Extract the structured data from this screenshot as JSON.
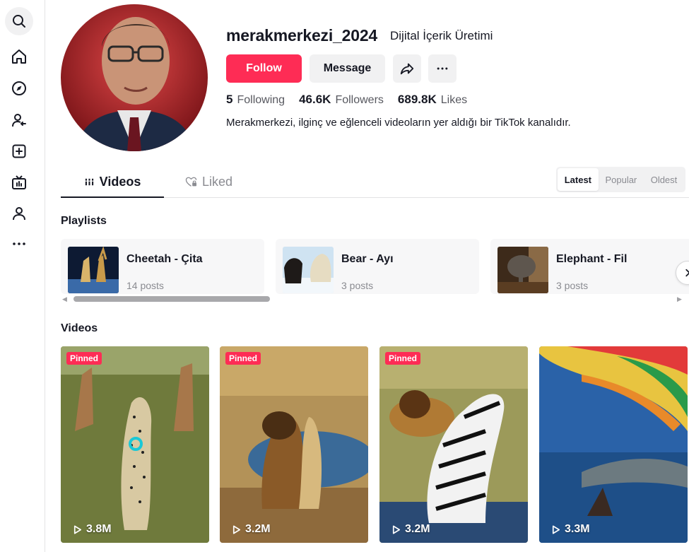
{
  "profile": {
    "username": "merakmerkezi_2024",
    "nickname": "Dijital İçerik Üretimi",
    "bio": "Merakmerkezi, ilginç ve eğlenceli videoların yer aldığı bir TikTok kanalıdır."
  },
  "actions": {
    "follow_label": "Follow",
    "message_label": "Message"
  },
  "stats": {
    "following_count": "5",
    "following_label": "Following",
    "followers_count": "46.6K",
    "followers_label": "Followers",
    "likes_count": "689.8K",
    "likes_label": "Likes"
  },
  "tabs": {
    "videos_label": "Videos",
    "liked_label": "Liked"
  },
  "sort": {
    "options": [
      "Latest",
      "Popular",
      "Oldest"
    ],
    "selected": "Latest"
  },
  "sections": {
    "playlists_title": "Playlists",
    "videos_title": "Videos"
  },
  "playlists": [
    {
      "title": "Cheetah - Çita",
      "count": "14 posts"
    },
    {
      "title": "Bear - Ayı",
      "count": "3 posts"
    },
    {
      "title": "Elephant - Fil",
      "count": "3 posts"
    }
  ],
  "videos": [
    {
      "badge": "Pinned",
      "views": "3.8M"
    },
    {
      "badge": "Pinned",
      "views": "3.2M"
    },
    {
      "badge": "Pinned",
      "views": "3.2M"
    },
    {
      "badge": "",
      "views": "3.3M"
    }
  ],
  "icons": {
    "rail": [
      "search-icon",
      "home-icon",
      "explore-icon",
      "following-icon",
      "upload-icon",
      "live-icon",
      "profile-icon",
      "more-icon"
    ],
    "share": "share-icon",
    "more": "more-icon",
    "liked_tab": "liked-lock-icon",
    "videos_tab": "grid-icon",
    "play": "play-icon"
  },
  "colors": {
    "accent": "#fe2c55",
    "text": "#161823",
    "muted": "#8a8b91",
    "surface": "#f1f1f2"
  }
}
